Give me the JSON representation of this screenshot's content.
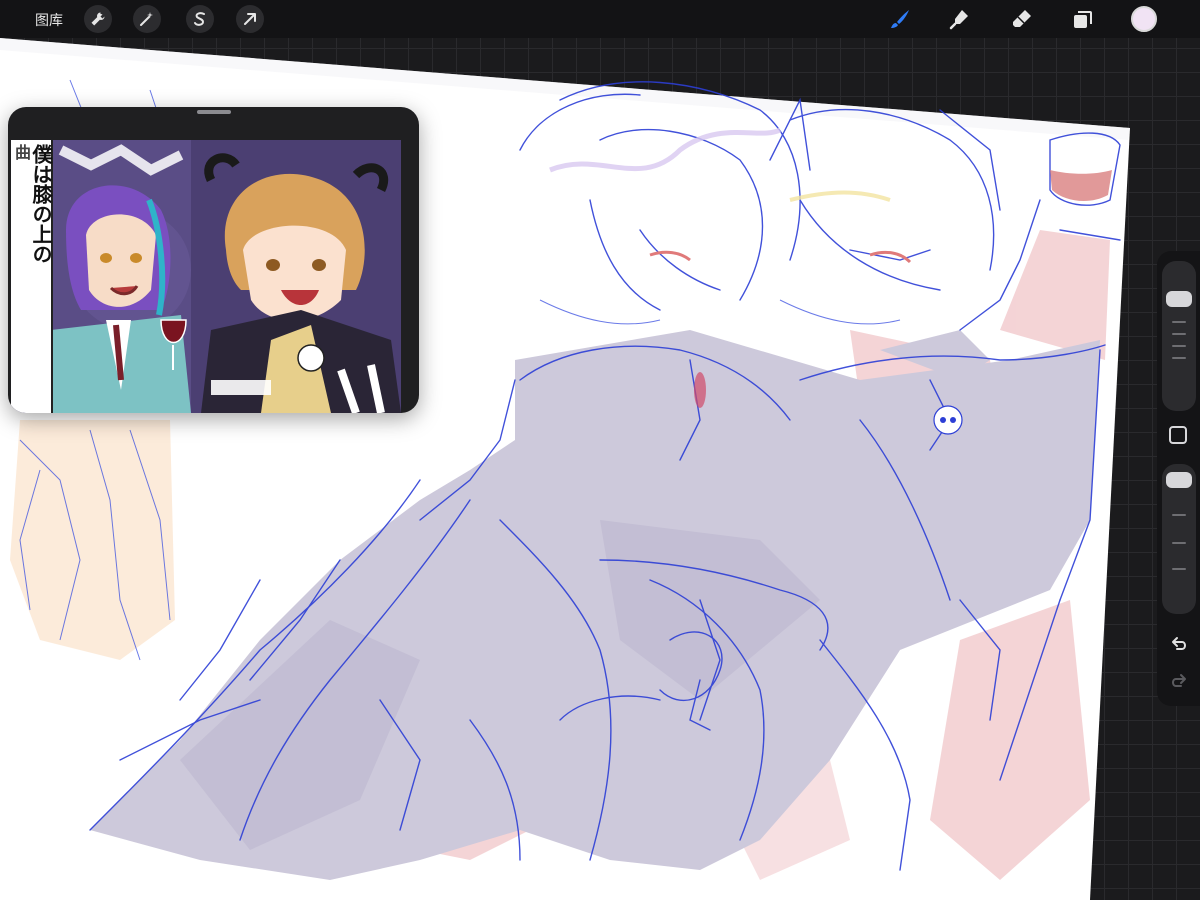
{
  "toolbar": {
    "gallery_label": "图库",
    "left_tools": [
      {
        "name": "actions",
        "icon": "wrench-icon"
      },
      {
        "name": "adjustments",
        "icon": "magic-wand-icon"
      },
      {
        "name": "selection",
        "icon": "selection-s-icon"
      },
      {
        "name": "transform",
        "icon": "arrow-cursor-icon"
      }
    ],
    "right_tools": [
      {
        "name": "brush",
        "icon": "brush-icon",
        "active": true
      },
      {
        "name": "smudge",
        "icon": "smudge-icon"
      },
      {
        "name": "eraser",
        "icon": "eraser-icon"
      },
      {
        "name": "layers",
        "icon": "layers-icon"
      }
    ],
    "current_color": "#f1e3f4",
    "active_color": "#2f7cf6"
  },
  "reference": {
    "vertical_text_1": "僕は膝の上の",
    "vertical_text_2": "曲",
    "bg_color": "#5b4f87"
  },
  "sidebar": {
    "brush_size_slider": {
      "icon": "brush-size-slider"
    },
    "modifier_button": {
      "icon": "square-modifier-icon"
    },
    "opacity_slider": {
      "icon": "opacity-slider"
    },
    "undo": {
      "icon": "undo-icon"
    },
    "redo": {
      "icon": "redo-icon"
    }
  },
  "colors": {
    "sketch_blue": "#2d3fd6",
    "fill_lavender": "#c9c5d8",
    "fill_pink": "#f2c9cc",
    "canvas_white": "#ffffff"
  }
}
